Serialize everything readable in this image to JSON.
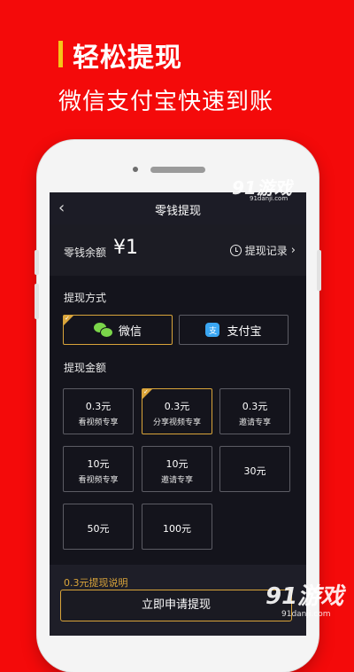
{
  "promo": {
    "title": "轻松提现",
    "subtitle": "微信支付宝快速到账"
  },
  "nav": {
    "back_icon": "back-chevron-icon",
    "title": "零钱提现"
  },
  "balance": {
    "label": "零钱余额",
    "value": "¥1",
    "record_label": "提现记录",
    "record_chevron": "›"
  },
  "methods": {
    "label": "提现方式",
    "items": [
      {
        "label": "微信",
        "icon": "wechat-icon",
        "selected": true
      },
      {
        "label": "支付宝",
        "icon": "alipay-icon",
        "icon_char": "支",
        "selected": false
      }
    ]
  },
  "amounts": {
    "label": "提现金额",
    "items": [
      {
        "value": "0.3元",
        "note": "看视频专享",
        "selected": false
      },
      {
        "value": "0.3元",
        "note": "分享视频专享",
        "selected": true
      },
      {
        "value": "0.3元",
        "note": "邀请专享",
        "selected": false
      },
      {
        "value": "10元",
        "note": "看视频专享",
        "selected": false
      },
      {
        "value": "10元",
        "note": "邀请专享",
        "selected": false
      },
      {
        "value": "30元",
        "note": "",
        "selected": false
      },
      {
        "value": "50元",
        "note": "",
        "selected": false
      },
      {
        "value": "100元",
        "note": "",
        "selected": false
      }
    ]
  },
  "footer": {
    "description_title": "0.3元提现说明",
    "apply_button": "立即申请提现"
  },
  "watermark": {
    "brand": "91游戏",
    "domain": "91danji.com"
  },
  "colors": {
    "background": "#f40a0a",
    "accent_gold": "#d9a43a",
    "screen_bg": "#14141c",
    "wechat_green": "#7bd64a",
    "alipay_blue": "#3aa6f2"
  }
}
